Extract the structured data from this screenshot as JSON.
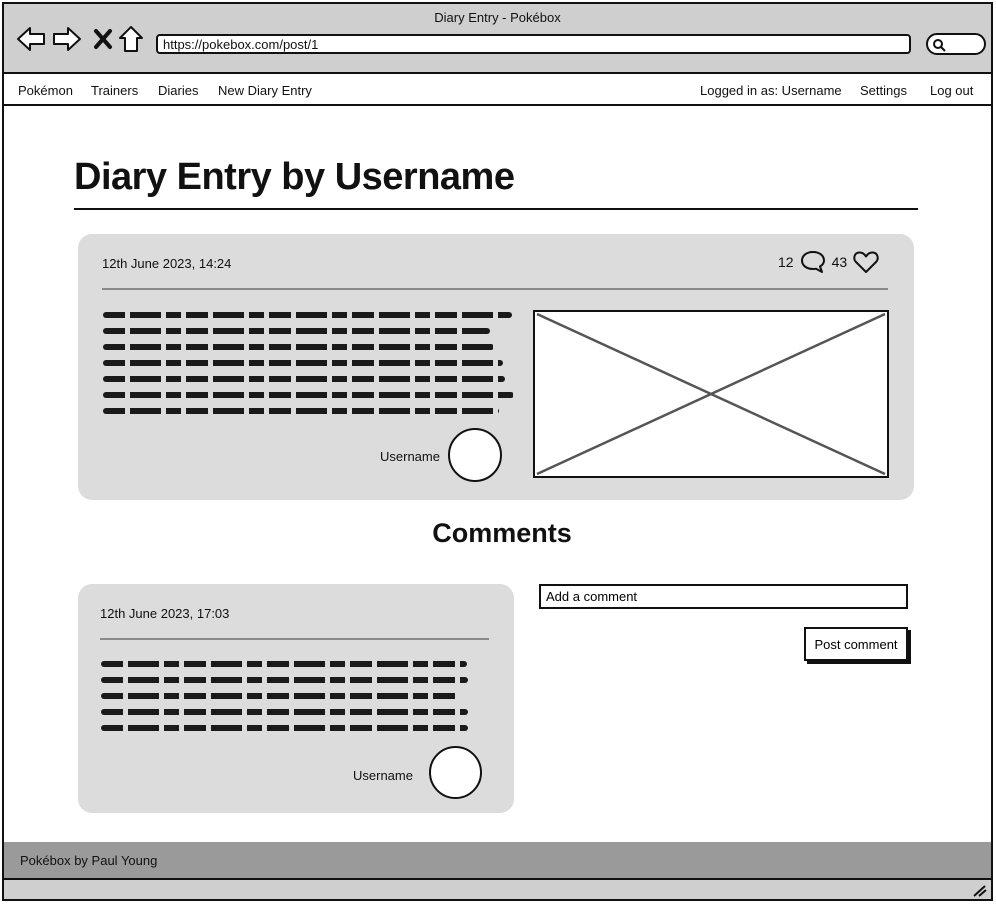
{
  "window": {
    "title": "Diary Entry - Pokébox"
  },
  "browser": {
    "url": "https://pokebox.com/post/1"
  },
  "nav": {
    "left": [
      "Pokémon",
      "Trainers",
      "Diaries",
      "New Diary Entry"
    ],
    "logged_in": "Logged in as: Username",
    "settings": "Settings",
    "logout": "Log out"
  },
  "page": {
    "title": "Diary Entry by Username"
  },
  "post": {
    "date": "12th June 2023, 14:24",
    "comment_count": "12",
    "like_count": "43",
    "author": "Username"
  },
  "comments": {
    "heading": "Comments",
    "items": [
      {
        "date": "12th June 2023, 17:03",
        "author": "Username"
      }
    ],
    "input_value": "Add a comment",
    "post_label": "Post comment"
  },
  "footer": {
    "text": "Pokébox by Paul Young"
  },
  "icons": [
    "back-icon",
    "forward-icon",
    "close-icon",
    "home-icon",
    "search-icon",
    "comment-icon",
    "heart-icon",
    "image-placeholder-icon",
    "resize-grip-icon"
  ],
  "colors": {
    "chrome": "#cfcfcf",
    "card": "#dcdcdc",
    "footer": "#9a9a9a",
    "ink": "#111111"
  }
}
